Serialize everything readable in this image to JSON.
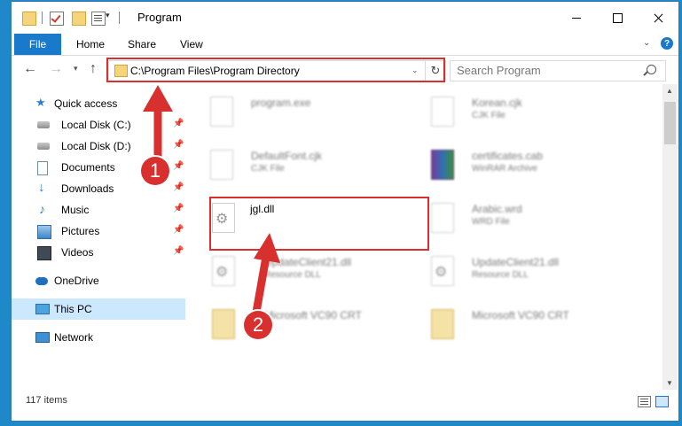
{
  "window": {
    "title": "Program",
    "quick_access_dropdown": "▾"
  },
  "ribbon": {
    "file": "File",
    "home": "Home",
    "share": "Share",
    "view": "View",
    "help": "?"
  },
  "nav": {
    "back": "←",
    "forward": "→",
    "recent": "▾",
    "up": "↑",
    "address": "C:\\Program Files\\Program Directory",
    "refresh": "↻",
    "search_placeholder": "Search Program"
  },
  "sidebar": {
    "items": [
      {
        "label": "Quick access",
        "icon": "star-icon",
        "pinned": false
      },
      {
        "label": "Local Disk (C:)",
        "icon": "disk-icon",
        "pinned": true
      },
      {
        "label": "Local Disk (D:)",
        "icon": "disk-icon",
        "pinned": true
      },
      {
        "label": "Documents",
        "icon": "documents-icon",
        "pinned": true
      },
      {
        "label": "Downloads",
        "icon": "downloads-icon",
        "pinned": true
      },
      {
        "label": "Music",
        "icon": "music-icon",
        "pinned": true
      },
      {
        "label": "Pictures",
        "icon": "pictures-icon",
        "pinned": true
      },
      {
        "label": "Videos",
        "icon": "videos-icon",
        "pinned": true
      },
      {
        "label": "OneDrive",
        "icon": "cloud-icon",
        "pinned": false
      },
      {
        "label": "This PC",
        "icon": "computer-icon",
        "pinned": false,
        "selected": true
      },
      {
        "label": "Network",
        "icon": "network-icon",
        "pinned": false
      }
    ]
  },
  "files": [
    {
      "name": "program.exe",
      "type": ""
    },
    {
      "name": "Korean.cjk",
      "type": "CJK File"
    },
    {
      "name": "DefaultFont.cjk",
      "type": "CJK File"
    },
    {
      "name": "certificates.cab",
      "type": "WinRAR Archive"
    },
    {
      "name": "jgl.dll",
      "type": ""
    },
    {
      "name": "Arabic.wrd",
      "type": "WRD File"
    },
    {
      "name": "UpdateClient21.dll",
      "type": "Resource DLL"
    },
    {
      "name": "UpdateClient21.dll",
      "type": "Resource DLL"
    },
    {
      "name": "Microsoft VC90 CRT",
      "type": ""
    },
    {
      "name": "Microsoft VC90 CRT",
      "type": ""
    }
  ],
  "status": {
    "count": "117 items"
  },
  "annotations": {
    "step1": "1",
    "step2": "2"
  },
  "colors": {
    "accent": "#1979ca",
    "highlight": "#d8302e",
    "selection": "#cce8ff",
    "desktop": "#1e88c9"
  }
}
